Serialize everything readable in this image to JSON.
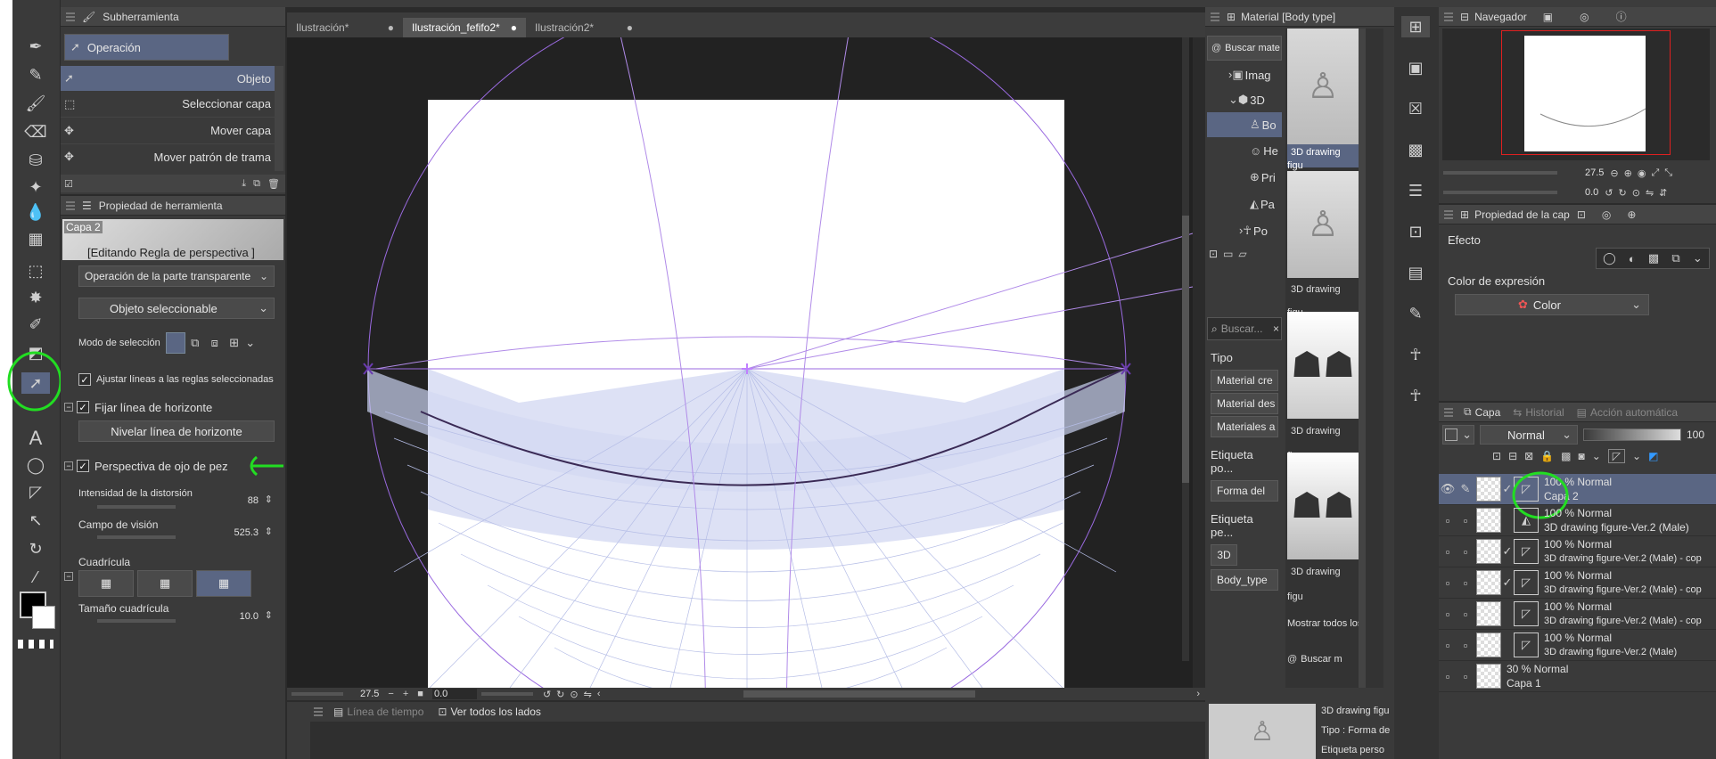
{
  "canvas_tabs": [
    {
      "label": "Ilustración*",
      "active": false
    },
    {
      "label": "Ilustración_fefifo2*",
      "active": true
    },
    {
      "label": "Ilustración2*",
      "active": false
    }
  ],
  "subtool_panel": {
    "title": "Subherramienta",
    "group": "Operación",
    "items": [
      "Objeto",
      "Seleccionar capa",
      "Mover capa",
      "Mover patrón de trama"
    ]
  },
  "tool_property": {
    "title": "Propiedad de herramienta",
    "layer_name": "Capa 2",
    "editing_label": "[Editando Regla de perspectiva ]",
    "dropdown_transparent": "Operación de la parte transparente",
    "dropdown_object": "Objeto seleccionable",
    "selection_mode_label": "Modo de selección",
    "snap_label": "Ajustar líneas a las reglas seleccionadas",
    "fix_horizon_label": "Fijar línea de horizonte",
    "level_horizon_button": "Nivelar línea de horizonte",
    "fisheye_label": "Perspectiva de ojo de pez",
    "distortion_label": "Intensidad de la distorsión",
    "distortion_value": "88",
    "fov_label": "Campo de visión",
    "fov_value": "525.3",
    "grid_label": "Cuadrícula",
    "grid_size_label": "Tamaño cuadrícula",
    "grid_size_value": "10.0"
  },
  "canvas_status": {
    "zoom": "27.5",
    "angle": "0.0"
  },
  "timeline": {
    "timeline_label": "Línea de tiempo",
    "all_sides_label": "Ver todos los lados"
  },
  "material_panel": {
    "title": "Material [Body type]",
    "search_button": "Buscar mate",
    "tree": [
      "Imag",
      "3D",
      "Bo",
      "He",
      "Pri",
      "Pa",
      "Po"
    ],
    "search_placeholder": "Buscar...",
    "type_label": "Tipo",
    "type_items": [
      "Material cre",
      "Material des",
      "Materiales a"
    ],
    "tag_label_1": "Etiqueta po...",
    "tag_item_1": "Forma del",
    "tag_label_2": "Etiqueta pe...",
    "tag_items_2": [
      "3D",
      "Body_type"
    ],
    "thumbnails": [
      "3D drawing figu",
      "3D drawing figu",
      "3D drawing figu",
      "3D drawing figu"
    ],
    "show_all": "Mostrar todos los",
    "search_bottom": "Buscar m",
    "detail_title": "3D drawing figu",
    "detail_type": "Tipo : Forma de",
    "detail_tag": "Etiqueta perso"
  },
  "navigator": {
    "title": "Navegador",
    "zoom": "27.5",
    "angle": "0.0"
  },
  "layer_property": {
    "title": "Propiedad de la cap",
    "effect_label": "Efecto",
    "expression_color_label": "Color de expresión",
    "expression_color_value": "Color"
  },
  "layer_panel": {
    "tabs": [
      "Capa",
      "Historial",
      "Acción automática"
    ],
    "blend_mode": "Normal",
    "opacity": "100",
    "layers": [
      {
        "mode": "100 % Normal",
        "name": "Capa 2",
        "selected": true
      },
      {
        "mode": "100 % Normal",
        "name": "3D drawing figure-Ver.2 (Male)",
        "selected": false
      },
      {
        "mode": "100 % Normal",
        "name": "3D drawing figure-Ver.2 (Male) - cop",
        "selected": false
      },
      {
        "mode": "100 % Normal",
        "name": "3D drawing figure-Ver.2 (Male) - cop",
        "selected": false
      },
      {
        "mode": "100 % Normal",
        "name": "3D drawing figure-Ver.2 (Male) - cop",
        "selected": false
      },
      {
        "mode": "100 % Normal",
        "name": "3D drawing figure-Ver.2 (Male)",
        "selected": false
      },
      {
        "mode": "30 % Normal",
        "name": "Capa 1",
        "selected": false
      }
    ]
  },
  "colors": {
    "accent": "#5a6683",
    "annotation": "#22dd22",
    "guide": "#9a6ae0"
  }
}
